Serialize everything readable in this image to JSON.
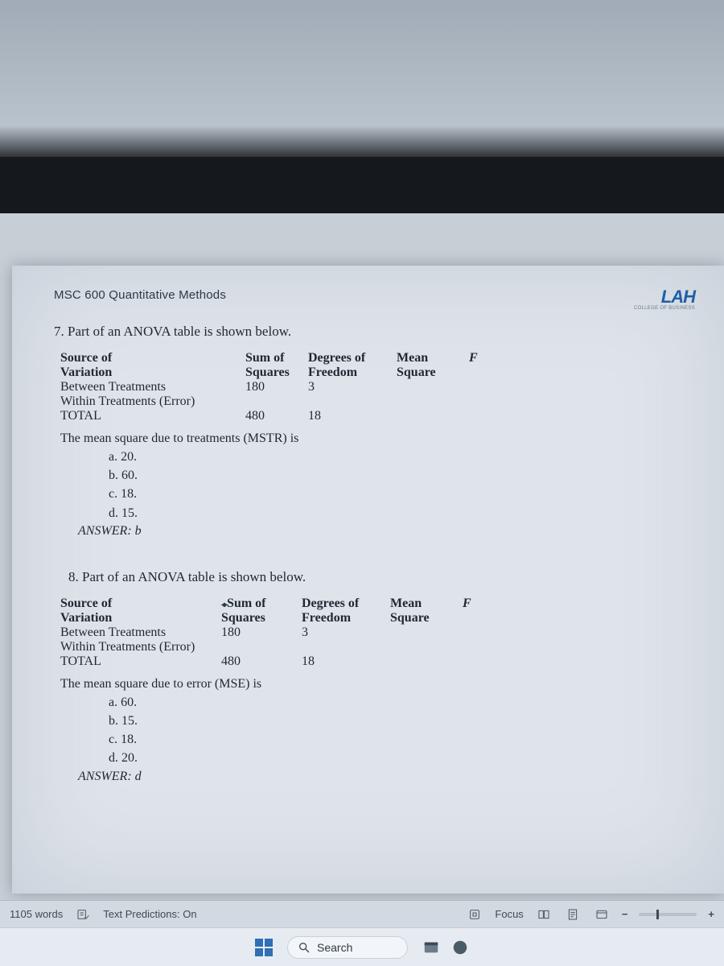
{
  "header": {
    "course": "MSC 600 Quantitative Methods",
    "logo": "LAH",
    "logo_sub": "COLLEGE OF BUSINESS"
  },
  "q7": {
    "title": "7. Part of an ANOVA table is shown below.",
    "cols": {
      "src": "Source of Variation",
      "ss": "Sum of Squares",
      "df": "Degrees of Freedom",
      "ms": "Mean Square",
      "f": "F"
    },
    "rows": [
      {
        "src": "Between Treatments",
        "ss": "180",
        "df": "3"
      },
      {
        "src": "Within Treatments (Error)",
        "ss": "",
        "df": ""
      },
      {
        "src": "TOTAL",
        "ss": "480",
        "df": "18"
      }
    ],
    "stem": "The mean square due to treatments (MSTR) is",
    "opts": {
      "a": "a. 20.",
      "b": "b. 60.",
      "c": "c. 18.",
      "d": "d. 15."
    },
    "answer": "ANSWER: b"
  },
  "q8": {
    "title": "8. Part of an ANOVA table is shown below.",
    "cols": {
      "src": "Source of Variation",
      "ss": "Sum of Squares",
      "df": "Degrees of Freedom",
      "ms": "Mean Square",
      "f": "F"
    },
    "rows": [
      {
        "src": "Between Treatments",
        "ss": "180",
        "df": "3"
      },
      {
        "src": "Within Treatments (Error)",
        "ss": "",
        "df": ""
      },
      {
        "src": "TOTAL",
        "ss": "480",
        "df": "18"
      }
    ],
    "stem": "The mean square due to error (MSE) is",
    "opts": {
      "a": "a. 60.",
      "b": "b. 15.",
      "c": "c. 18.",
      "d": "d. 20."
    },
    "answer": "ANSWER: d"
  },
  "statusbar": {
    "words": "1105 words",
    "predictions": "Text Predictions: On",
    "focus": "Focus"
  },
  "taskbar": {
    "search": "Search"
  }
}
